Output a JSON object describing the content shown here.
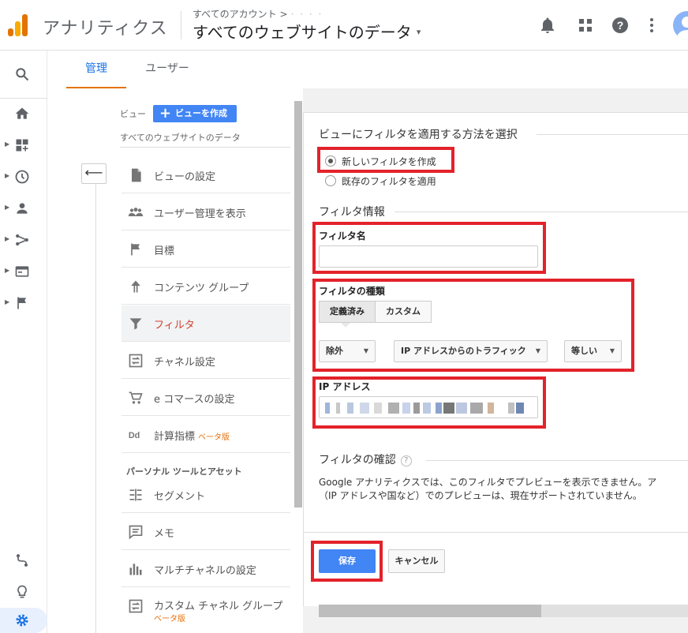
{
  "header": {
    "app_name": "アナリティクス",
    "breadcrumb": "すべてのアカウント >",
    "breadcrumb_account": "· · · ·",
    "property_title": "すべてのウェブサイトのデータ",
    "caret": "▾",
    "icons": [
      "bell-icon",
      "apps-grid-icon",
      "help-icon",
      "more-vert-icon",
      "avatar"
    ]
  },
  "rail": {
    "items": [
      "search-icon",
      "home-icon",
      "customization-icon",
      "realtime-icon",
      "audience-icon",
      "acquisition-icon",
      "behavior-icon",
      "conversions-icon"
    ],
    "bottom": [
      "attribution-icon",
      "discover-icon",
      "admin-settings-icon"
    ]
  },
  "tabs": {
    "admin": "管理",
    "user": "ユーザー"
  },
  "view_column": {
    "label": "ビュー",
    "create_button": "ビューを作成",
    "create_plus": "+",
    "view_name": "すべてのウェブサイトのデータ",
    "back_arrow": "⟵",
    "menu": [
      {
        "label": "ビューの設定",
        "icon": "document-icon"
      },
      {
        "label": "ユーザー管理を表示",
        "icon": "people-icon"
      },
      {
        "label": "目標",
        "icon": "flag-icon"
      },
      {
        "label": "コンテンツ グループ",
        "icon": "content-group-icon"
      },
      {
        "label": "フィルタ",
        "icon": "filter-icon"
      },
      {
        "label": "チャネル設定",
        "icon": "channel-settings-icon"
      },
      {
        "label": "e コマースの設定",
        "icon": "cart-icon"
      },
      {
        "label": "計算指標",
        "icon": "dd-icon",
        "badge": "ベータ版"
      }
    ],
    "section": "パーソナル ツールとアセット",
    "personal_menu": [
      {
        "label": "セグメント",
        "icon": "segment-icon"
      },
      {
        "label": "メモ",
        "icon": "note-icon"
      },
      {
        "label": "マルチチャネルの設定",
        "icon": "bars-icon"
      },
      {
        "label": "カスタム チャネル グループ",
        "icon": "custom-channel-icon",
        "badge": "ベータ版"
      }
    ]
  },
  "panel": {
    "method_heading": "ビューにフィルタを適用する方法を選択",
    "radio_new": "新しいフィルタを作成",
    "radio_existing": "既存のフィルタを適用",
    "info_heading": "フィルタ情報",
    "filter_name_label": "フィルタ名",
    "filter_name_value": "",
    "filter_type_label": "フィルタの種類",
    "seg_predefined": "定義済み",
    "seg_custom": "カスタム",
    "dd_exclude": "除外",
    "dd_source": "IP アドレスからのトラフィック",
    "dd_operator": "等しい",
    "dd_caret": "▼",
    "ip_label": "IP アドレス",
    "confirm_heading": "フィルタの確認",
    "confirm_help": "?",
    "confirm_line1": "Google アナリティクスでは、このフィルタでプレビューを表示できません。ア",
    "confirm_line2": "（IP アドレスや国など）でのプレビューは、現在サポートされていません。",
    "save": "保存",
    "cancel": "キャンセル"
  },
  "colors": {
    "accent_blue": "#4285f4",
    "annotation_red": "#e3222a",
    "active_red": "#d23f31",
    "tab_orange": "#e37400",
    "beta_orange": "#e8710a"
  }
}
